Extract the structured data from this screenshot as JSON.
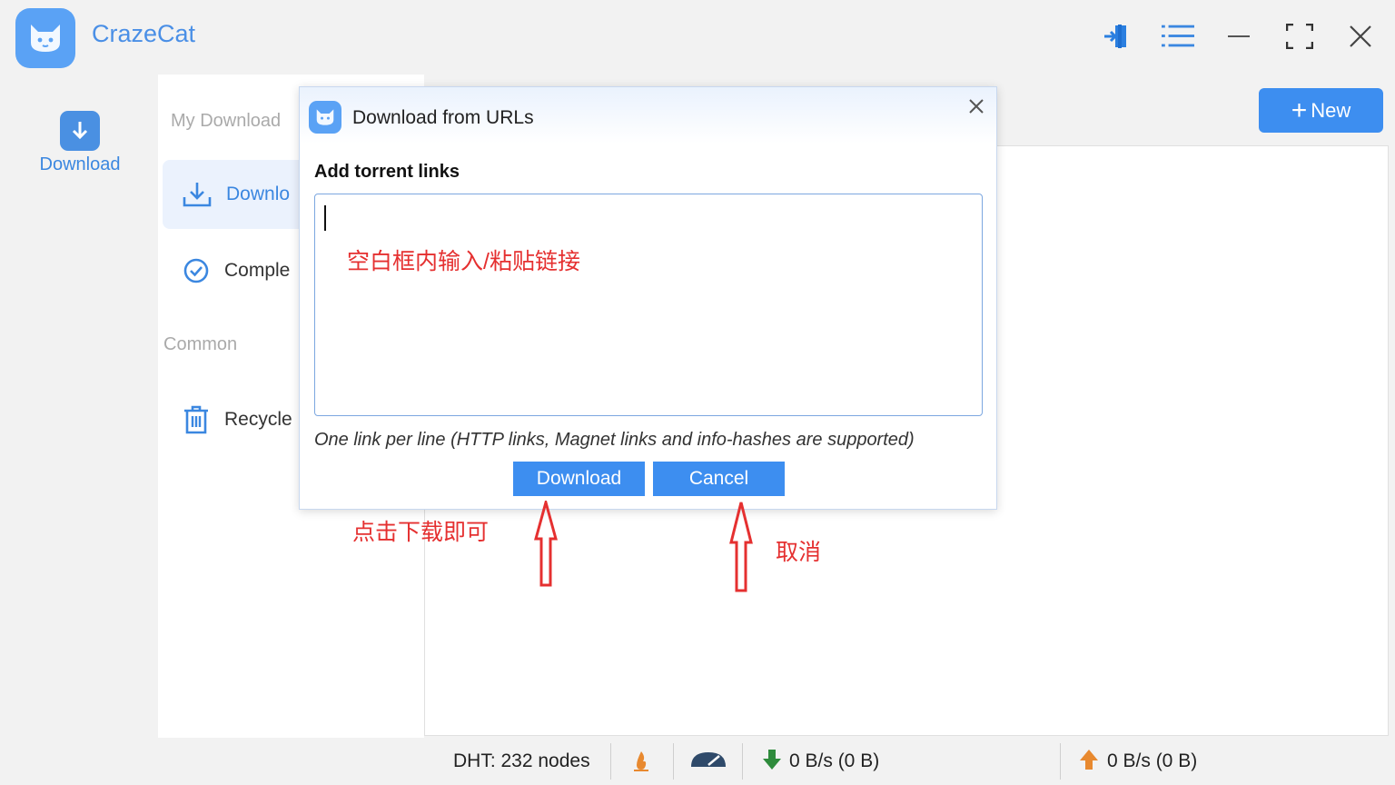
{
  "app": {
    "title": "CrazeCat",
    "accent": "#3d8ef0"
  },
  "titlebar": {
    "icons": [
      "sign-in-icon",
      "menu-list-icon",
      "minimize-icon",
      "maximize-icon",
      "close-icon"
    ]
  },
  "rail": {
    "download_label": "Download"
  },
  "sidebar": {
    "my_downloads_label": "My Download",
    "items": [
      {
        "label": "Downlo",
        "icon": "download-icon",
        "active": true
      },
      {
        "label": "Comple",
        "icon": "check-circle-icon",
        "active": false
      }
    ],
    "common_label": "Common",
    "common_items": [
      {
        "label": "Recycle",
        "icon": "trash-icon"
      }
    ]
  },
  "main": {
    "new_button_label": "New"
  },
  "dialog": {
    "title": "Download from URLs",
    "add_label": "Add torrent links",
    "textarea_value": "",
    "hint": "One link per line (HTTP links, Magnet links and info-hashes are supported)",
    "download_label": "Download",
    "cancel_label": "Cancel"
  },
  "annotations": {
    "textarea_note": "空白框内输入/粘贴链接",
    "download_note": "点击下载即可",
    "cancel_note": "取消",
    "color": "#e53030"
  },
  "statusbar": {
    "dht": "DHT: 232 nodes",
    "down_speed": "0 B/s (0 B)",
    "up_speed": "0 B/s (0 B)"
  }
}
